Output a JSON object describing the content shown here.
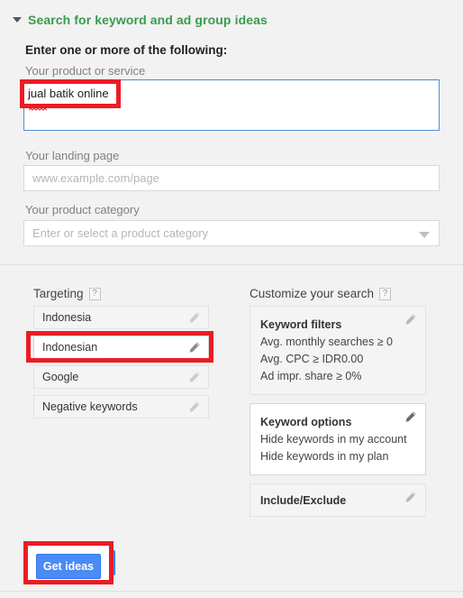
{
  "section": {
    "title": "Search for keyword and ad group ideas",
    "disclosure_icon": "triangle-down-icon",
    "accent_color": "#3a9a4e"
  },
  "form": {
    "heading": "Enter one or more of the following:",
    "product_service": {
      "label": "Your product or service",
      "value": "jual batik online"
    },
    "landing_page": {
      "label": "Your landing page",
      "placeholder": "www.example.com/page",
      "value": ""
    },
    "product_category": {
      "label": "Your product category",
      "placeholder": "Enter or select a product category",
      "value": "",
      "caret_icon": "chevron-down-icon"
    }
  },
  "targeting": {
    "title": "Targeting",
    "help_icon": "question-mark-icon",
    "help_label": "?",
    "rows": [
      {
        "label": "Indonesia",
        "edit_icon": "pencil-icon",
        "active": false
      },
      {
        "label": "Indonesian",
        "edit_icon": "pencil-icon",
        "active": true
      },
      {
        "label": "Google",
        "edit_icon": "pencil-icon",
        "active": false
      },
      {
        "label": "Negative keywords",
        "edit_icon": "pencil-icon",
        "active": false
      }
    ]
  },
  "customize": {
    "title": "Customize your search",
    "help_icon": "question-mark-icon",
    "help_label": "?",
    "panels": [
      {
        "title": "Keyword filters",
        "edit_icon": "pencil-icon",
        "lines": [
          "Avg. monthly searches ≥ 0",
          "Avg. CPC ≥ IDR0.00",
          "Ad impr. share ≥ 0%"
        ]
      },
      {
        "title": "Keyword options",
        "edit_icon": "pencil-icon",
        "lines": [
          "Hide keywords in my account",
          "Hide keywords in my plan"
        ]
      },
      {
        "title": "Include/Exclude",
        "edit_icon": "pencil-icon",
        "lines": []
      }
    ]
  },
  "actions": {
    "get_ideas_label": "Get ideas",
    "get_ideas_color": "#4a8bf4"
  },
  "annotations": {
    "highlight_color": "#ec1c24",
    "boxes": [
      "keyword-input-highlight",
      "indonesian-row-highlight",
      "get-ideas-highlight"
    ]
  }
}
